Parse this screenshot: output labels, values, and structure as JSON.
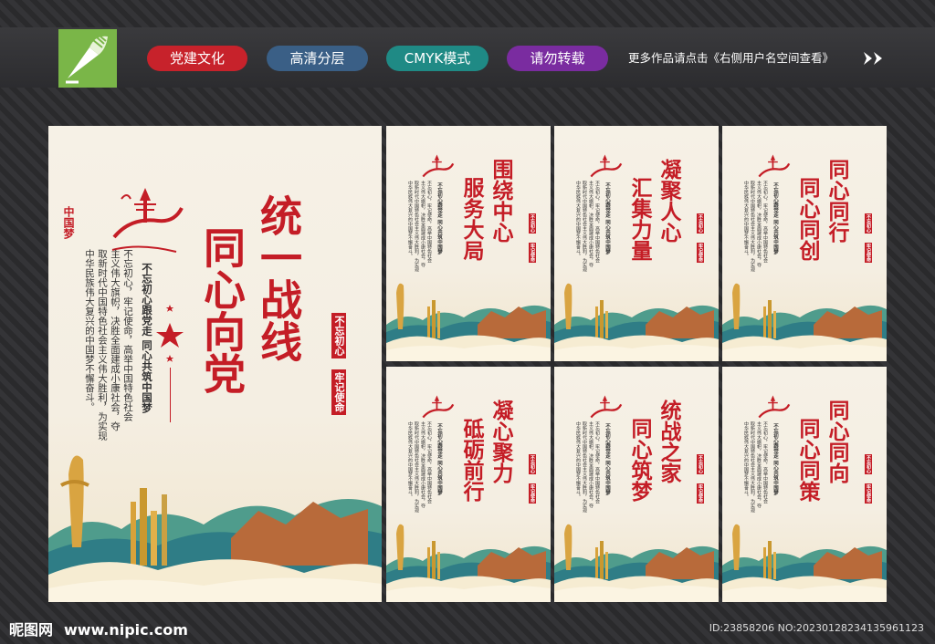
{
  "header": {
    "tags": [
      {
        "label": "党建文化",
        "color": "#c7222b"
      },
      {
        "label": "高清分层",
        "color": "#3a5f86"
      },
      {
        "label": "CMYK模式",
        "color": "#1f8a85"
      },
      {
        "label": "请勿转载",
        "color": "#7a2ca0"
      }
    ],
    "more_text": "更多作品请点击《右侧用户名空间查看》"
  },
  "main_poster": {
    "emblem_text": "中国梦",
    "title_col1": "统一战线",
    "title_col2": "同心向党",
    "slogan": "不忘初心跟党走 同心共筑中国梦",
    "body_col1": "不忘初心，牢记使命，高举中国特色社会",
    "body_col2": "主义伟大旗帜，决胜全面建成小康社会，夺",
    "body_col3": "取新时代中国特色社会主义伟大胜利，为实现",
    "body_col4": "中华民族伟大复兴的中国梦不懈奋斗。",
    "seal_col1": "不忘初心",
    "seal_col2": "牢记使命"
  },
  "small_posters": [
    {
      "title_col1": "围绕中心",
      "title_col2": "服务大局"
    },
    {
      "title_col1": "凝聚人心",
      "title_col2": "汇集力量"
    },
    {
      "title_col1": "同心同行",
      "title_col2": "同心同创"
    },
    {
      "title_col1": "凝心聚力",
      "title_col2": "砥砺前行"
    },
    {
      "title_col1": "统战之家",
      "title_col2": "同心筑梦"
    },
    {
      "title_col1": "同心同向",
      "title_col2": "同心同策"
    }
  ],
  "footer": {
    "site_name": "昵图网",
    "site_url": "www.nipic.com",
    "image_id": "ID:23858206 NO:20230128234135961123"
  },
  "colors": {
    "accent_red": "#c41d26",
    "logo_green": "#7ab648"
  }
}
